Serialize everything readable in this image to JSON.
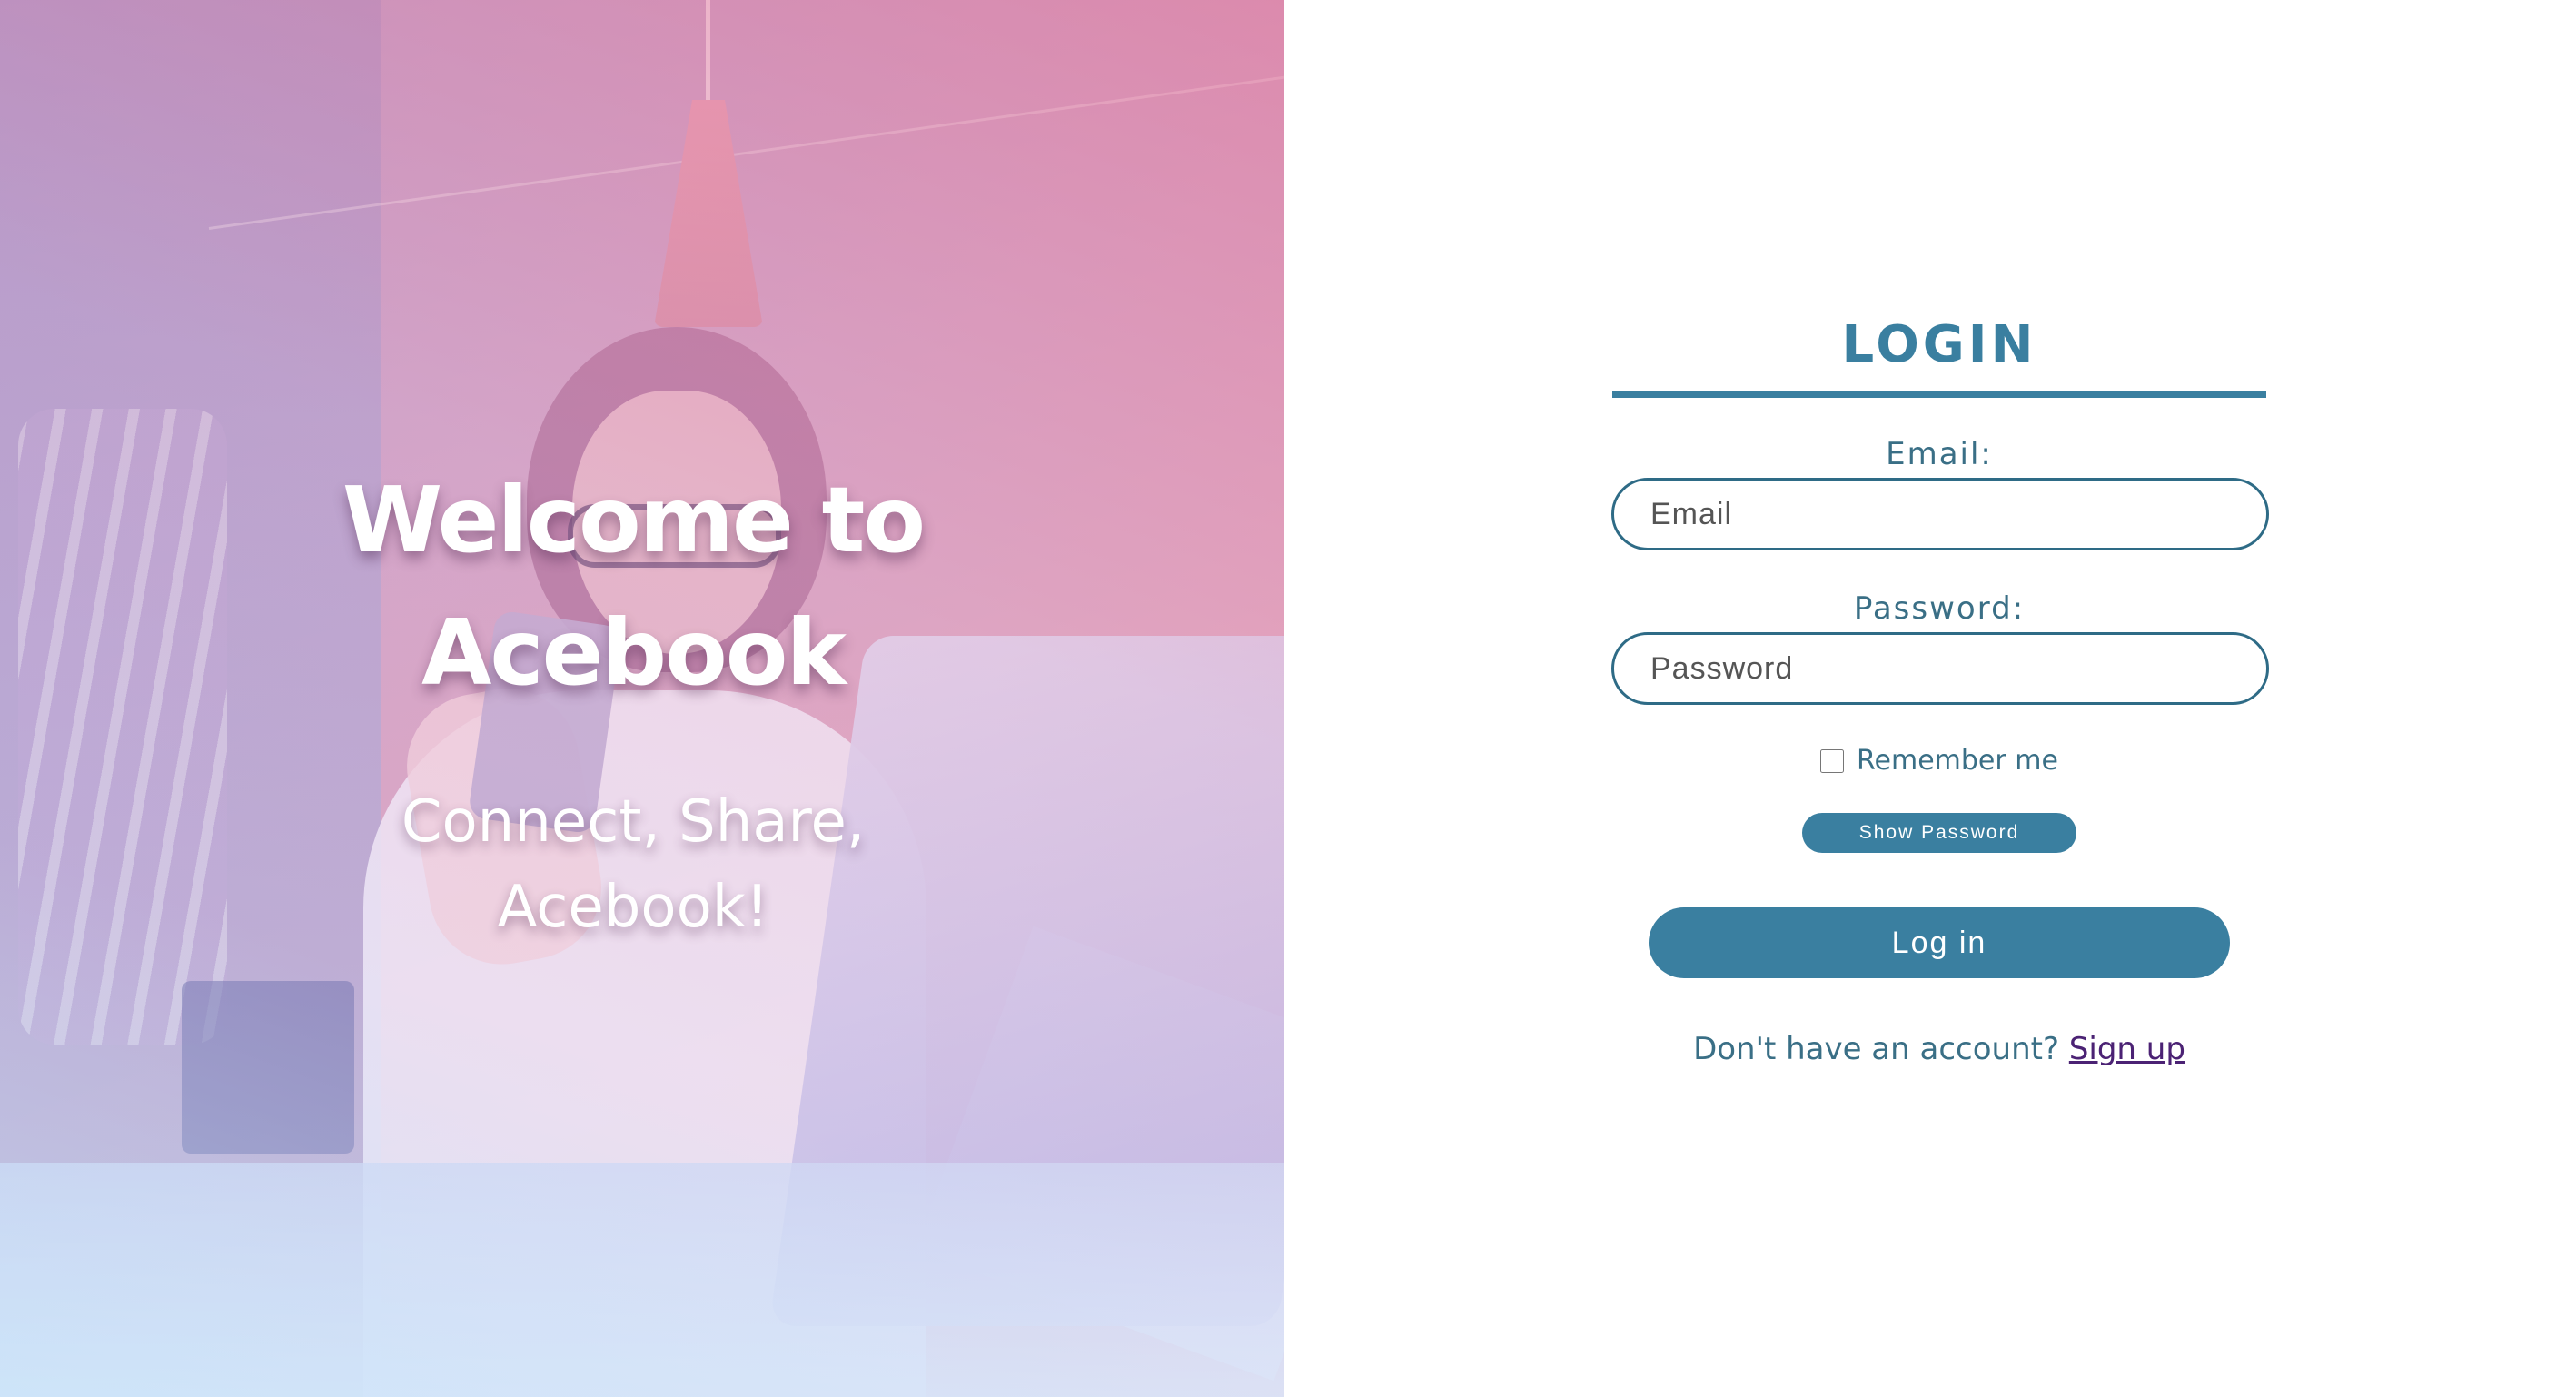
{
  "hero": {
    "title_line1": "Welcome to",
    "title_line2": "Acebook",
    "subtitle_line1": "Connect, Share,",
    "subtitle_line2": "Acebook!"
  },
  "login": {
    "title": "LOGIN",
    "email_label": "Email:",
    "email_placeholder": "Email",
    "password_label": "Password:",
    "password_placeholder": "Password",
    "remember_label": "Remember me",
    "remember_checked": false,
    "show_password_label": "Show Password",
    "login_button_label": "Log in",
    "signup_prompt": "Don't have an account?",
    "signup_link": "Sign up"
  },
  "colors": {
    "accent": "#3a7fa0",
    "link": "#4b2274",
    "text": "#3a6f86"
  }
}
